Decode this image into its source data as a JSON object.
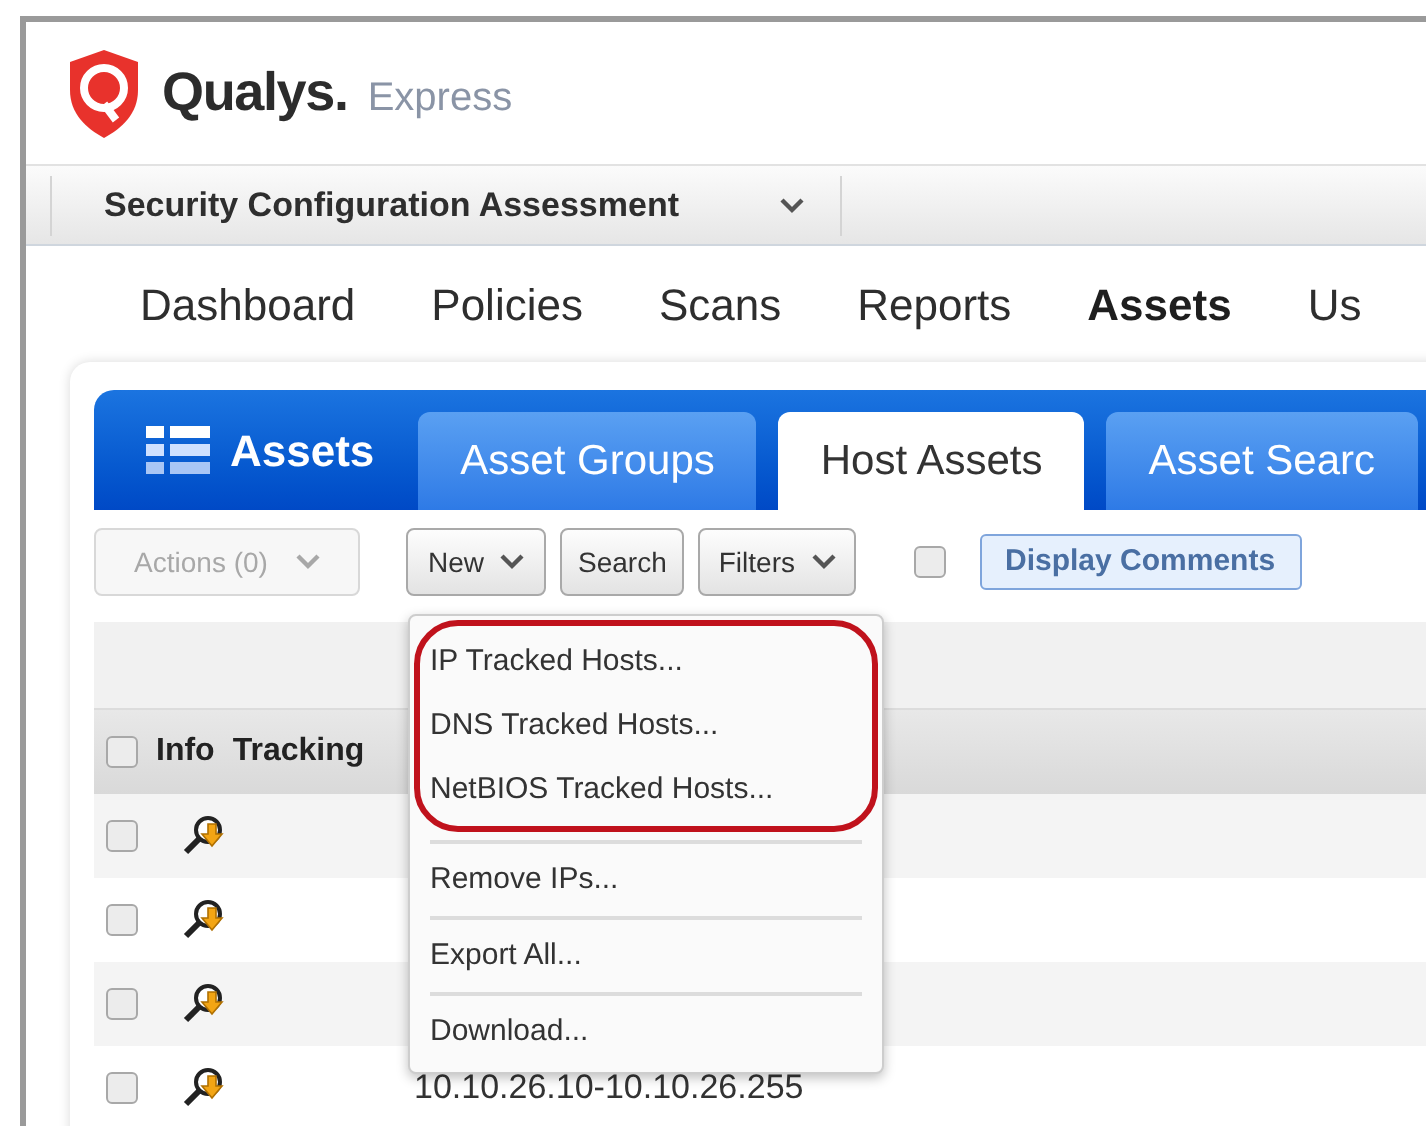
{
  "logo": {
    "brand": "Qualys.",
    "product": "Express"
  },
  "module_selector": {
    "label": "Security Configuration Assessment"
  },
  "nav": [
    {
      "label": "Dashboard",
      "selected": false
    },
    {
      "label": "Policies",
      "selected": false
    },
    {
      "label": "Scans",
      "selected": false
    },
    {
      "label": "Reports",
      "selected": false
    },
    {
      "label": "Assets",
      "selected": true
    },
    {
      "label": "Us",
      "selected": false
    }
  ],
  "panel_title": "Assets",
  "tabs": [
    {
      "label": "Asset Groups",
      "selected": false
    },
    {
      "label": "Host Assets",
      "selected": true
    },
    {
      "label": "Asset Searc",
      "selected": false
    }
  ],
  "toolbar": {
    "actions": {
      "label": "Actions (0)",
      "disabled": true
    },
    "new": "New",
    "search": "Search",
    "filters": "Filters",
    "display_comments": {
      "checked": false,
      "label": "Display Comments"
    }
  },
  "table": {
    "header_checked": false,
    "columns": [
      "Info",
      "Tracking"
    ],
    "rows": [
      {
        "checked": false
      },
      {
        "checked": false
      },
      {
        "checked": false
      },
      {
        "checked": false,
        "ip": "10.10.26.10-10.10.26.255"
      }
    ]
  },
  "menu": {
    "groups": [
      {
        "highlighted": true,
        "items": [
          "IP Tracked Hosts...",
          "DNS Tracked Hosts...",
          "NetBIOS Tracked Hosts..."
        ]
      },
      {
        "highlighted": false,
        "items": [
          "Remove IPs..."
        ]
      },
      {
        "highlighted": false,
        "items": [
          "Export All..."
        ]
      },
      {
        "highlighted": false,
        "items": [
          "Download..."
        ]
      }
    ]
  }
}
